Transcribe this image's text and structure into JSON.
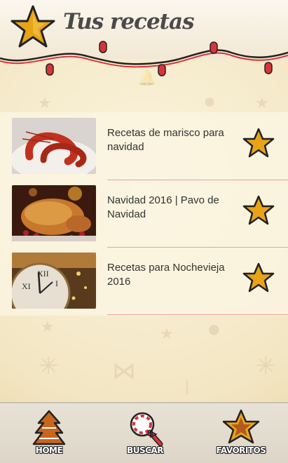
{
  "header": {
    "title": "Tus recetas"
  },
  "recipes": [
    {
      "title": "Recetas de marisco para navidad",
      "image": "shrimp-photo"
    },
    {
      "title": "Navidad 2016 | Pavo de Navidad",
      "image": "roast-turkey-photo"
    },
    {
      "title": "Recetas para Nochevieja 2016",
      "image": "clock-photo"
    }
  ],
  "nav": {
    "home_label": "HOME",
    "search_label": "BUSCAR",
    "favorites_label": "FAVORITOS"
  },
  "colors": {
    "star": "#e8a317",
    "accent_line": "#e9a39a",
    "light_red": "#d9343a"
  }
}
